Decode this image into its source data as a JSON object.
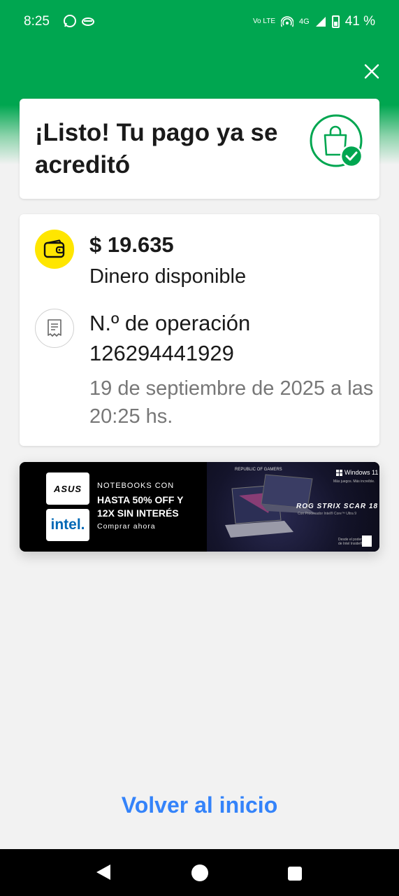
{
  "status_bar": {
    "time": "8:25",
    "volte": "Vo LTE",
    "network": "4G",
    "battery": "41 %",
    "icons": [
      "whatsapp-icon",
      "mate-icon",
      "hotspot-icon",
      "signal-icon",
      "battery-icon"
    ]
  },
  "header": {
    "close_icon": "close-icon"
  },
  "confirmation": {
    "title": "¡Listo! Tu pago ya se acreditó",
    "icon": "shopping-bag-check-icon"
  },
  "details": {
    "amount": "$ 19.635",
    "amount_label": "Dinero disponible",
    "operation_label": "N.º de operación",
    "operation_number": "126294441929",
    "operation_date": "19 de septiembre de 2025 a las 20:25 hs.",
    "icons": [
      "wallet-icon",
      "receipt-icon"
    ]
  },
  "banner": {
    "brand_logo": "ASUS",
    "partner_logo": "intel.",
    "eyebrow": "NOTEBOOKS CON",
    "headline": "HASTA 50% OFF Y 12X SIN INTERÉS",
    "cta": "Comprar ahora",
    "rog_mark": "REPUBLIC OF GAMERS",
    "windows_brand": "Windows 11",
    "windows_sub": "Más juegos. Más increíble.",
    "model": "ROG STRIX SCAR 18",
    "processor": "Con Procesador Intel® Core™ Ultra 9",
    "intel_inside": "Desde el poder de Intel Inside®"
  },
  "actions": {
    "back_to_home": "Volver al inicio"
  },
  "colors": {
    "brand_green": "#00a650",
    "link_blue": "#3483fa",
    "wallet_yellow": "#ffe600"
  }
}
